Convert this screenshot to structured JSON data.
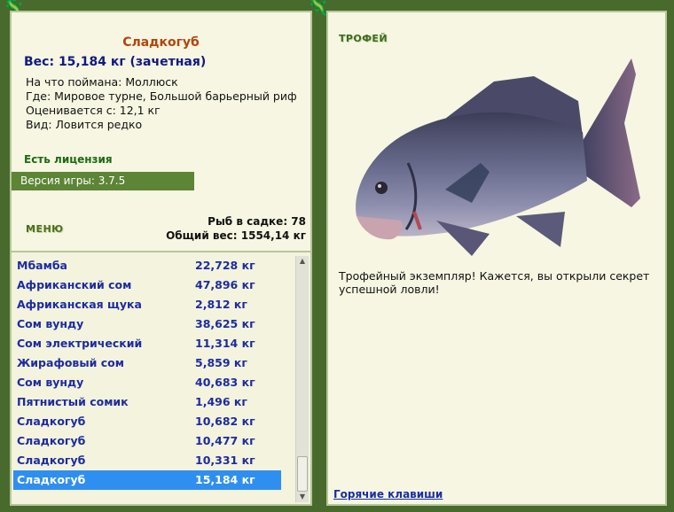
{
  "fish": {
    "name": "Сладкогуб",
    "weight_line": "Вес: 15,184 кг (зачетная)",
    "bait_line": "На что поймана: Моллюск",
    "where_line": "Где: Мировое турне, Большой барьерный риф",
    "value_line": "Оценивается с: 12,1 кг",
    "kind_line": "Вид: Ловится редко"
  },
  "license": "Есть лицензия",
  "version": "Версия игры: 3.7.5",
  "menu_label": "МЕНЮ",
  "stats": {
    "count_line": "Рыб в садке: 78",
    "total_line": "Общий вес: 1554,14 кг"
  },
  "catch_list": [
    {
      "name": "Мбамба",
      "weight": "22,728 кг"
    },
    {
      "name": "Африканский сом",
      "weight": "47,896 кг"
    },
    {
      "name": "Африканская щука",
      "weight": "2,812 кг"
    },
    {
      "name": "Сом вунду",
      "weight": "38,625 кг"
    },
    {
      "name": "Сом электрический",
      "weight": "11,314 кг"
    },
    {
      "name": "Жирафовый сом",
      "weight": "5,859 кг"
    },
    {
      "name": "Сом вунду",
      "weight": "40,683 кг"
    },
    {
      "name": "Пятнистый сомик",
      "weight": "1,496 кг"
    },
    {
      "name": "Сладкогуб",
      "weight": "10,682 кг"
    },
    {
      "name": "Сладкогуб",
      "weight": "10,477 кг"
    },
    {
      "name": "Сладкогуб",
      "weight": "10,331 кг"
    },
    {
      "name": "Сладкогуб",
      "weight": "15,184 кг"
    }
  ],
  "selected_index": 11,
  "trophy": {
    "title": "ТРОФЕЙ",
    "text": "Трофейный экземпляр! Кажется, вы открыли секрет успешной ловли!"
  },
  "hotkeys_link": "Горячие клавиши",
  "colors": {
    "background": "#486a2c",
    "selection": "#2f8ff0",
    "list_text": "#1c2ca0",
    "title": "#b4440c"
  }
}
